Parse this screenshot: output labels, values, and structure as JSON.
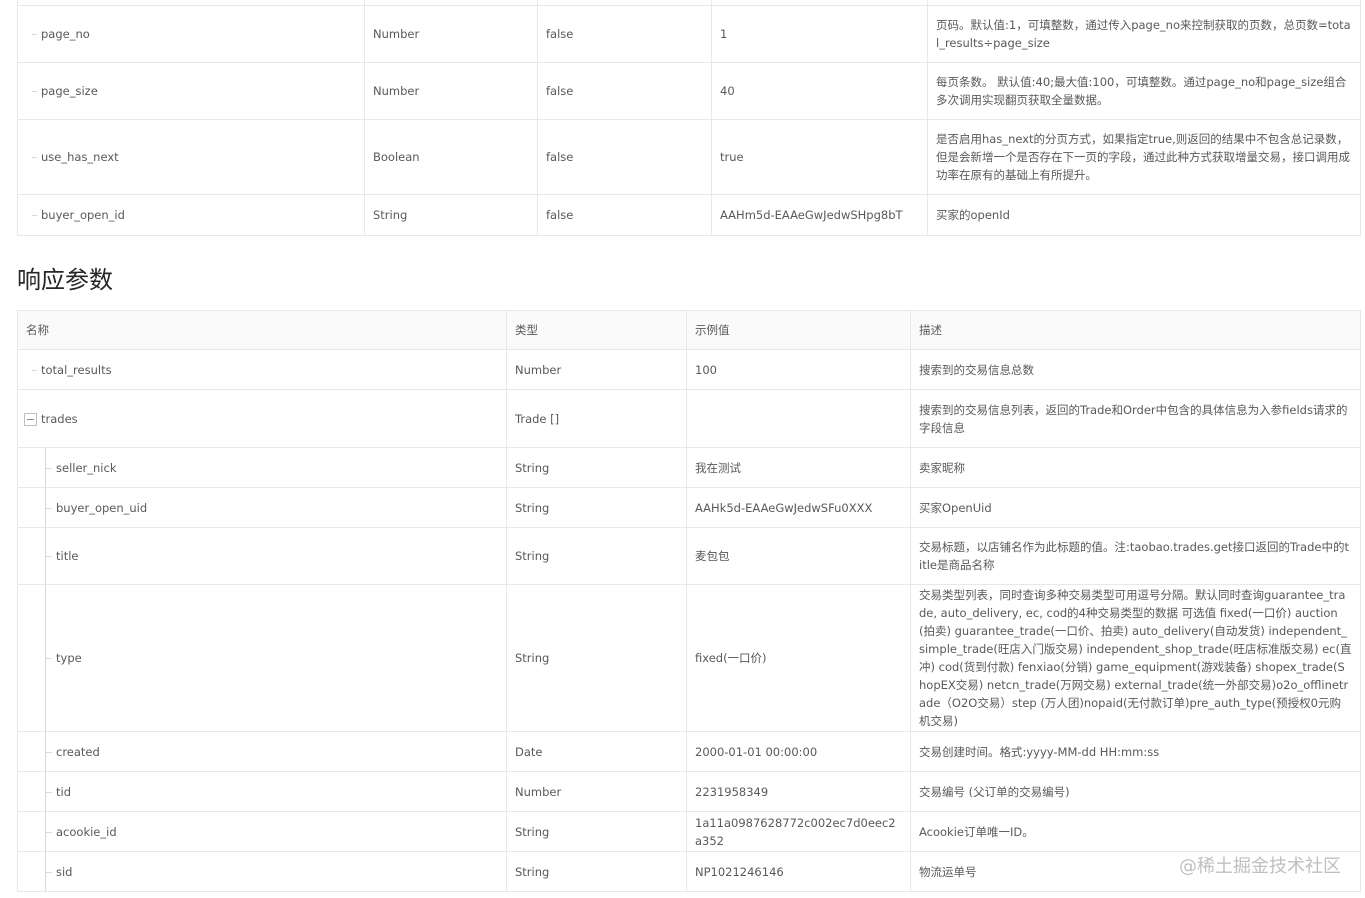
{
  "request_params": {
    "rows": [
      {
        "name": "page_no",
        "type": "Number",
        "required": "false",
        "example": "1",
        "desc": "页码。默认值:1，可填整数，通过传入page_no来控制获取的页数，总页数=total_results÷page_size"
      },
      {
        "name": "page_size",
        "type": "Number",
        "required": "false",
        "example": "40",
        "desc": "每页条数。 默认值:40;最大值:100，可填整数。通过page_no和page_size组合多次调用实现翻页获取全量数据。"
      },
      {
        "name": "use_has_next",
        "type": "Boolean",
        "required": "false",
        "example": "true",
        "desc": "是否启用has_next的分页方式，如果指定true,则返回的结果中不包含总记录数，但是会新增一个是否存在下一页的字段，通过此种方式获取增量交易，接口调用成功率在原有的基础上有所提升。"
      },
      {
        "name": "buyer_open_id",
        "type": "String",
        "required": "false",
        "example": "AAHm5d-EAAeGwJedwSHpg8bT",
        "desc": "买家的openId"
      }
    ]
  },
  "response_section": {
    "title": "响应参数",
    "headers": {
      "name": "名称",
      "type": "类型",
      "example": "示例值",
      "desc": "描述"
    },
    "rows": [
      {
        "name": "total_results",
        "type": "Number",
        "example": "100",
        "desc": "搜索到的交易信息总数"
      },
      {
        "name": "trades",
        "type": "Trade []",
        "example": "",
        "desc": "搜索到的交易信息列表，返回的Trade和Order中包含的具体信息为入参fields请求的字段信息"
      },
      {
        "name": "seller_nick",
        "type": "String",
        "example": "我在测试",
        "desc": "卖家昵称"
      },
      {
        "name": "buyer_open_uid",
        "type": "String",
        "example": "AAHk5d-EAAeGwJedwSFu0XXX",
        "desc": "买家OpenUid"
      },
      {
        "name": "title",
        "type": "String",
        "example": "麦包包",
        "desc": "交易标题，以店铺名作为此标题的值。注:taobao.trades.get接口返回的Trade中的title是商品名称"
      },
      {
        "name": "type",
        "type": "String",
        "example": "fixed(一口价)",
        "desc": "交易类型列表，同时查询多种交易类型可用逗号分隔。默认同时查询guarantee_trade, auto_delivery, ec, cod的4种交易类型的数据 可选值 fixed(一口价) auction(拍卖) guarantee_trade(一口价、拍卖) auto_delivery(自动发货) independent_simple_trade(旺店入门版交易) independent_shop_trade(旺店标准版交易) ec(直冲) cod(货到付款) fenxiao(分销) game_equipment(游戏装备) shopex_trade(ShopEX交易) netcn_trade(万网交易) external_trade(统一外部交易)o2o_offlinetrade（O2O交易）step (万人团)nopaid(无付款订单)pre_auth_type(预授权0元购机交易)"
      },
      {
        "name": "created",
        "type": "Date",
        "example": "2000-01-01 00:00:00",
        "desc": "交易创建时间。格式:yyyy-MM-dd HH:mm:ss"
      },
      {
        "name": "tid",
        "type": "Number",
        "example": "2231958349",
        "desc": "交易编号 (父订单的交易编号)"
      },
      {
        "name": "acookie_id",
        "type": "String",
        "example": "1a11a0987628772c002ec7d0eec2a352",
        "desc": "Acookie订单唯一ID。"
      },
      {
        "name": "sid",
        "type": "String",
        "example": "NP1021246146",
        "desc": "物流运单号"
      }
    ]
  },
  "watermark": "@稀土掘金技术社区"
}
